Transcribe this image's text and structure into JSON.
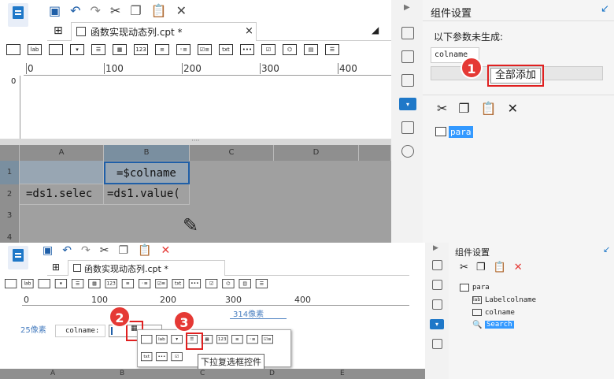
{
  "top": {
    "tab_title": "函数实现动态列.cpt *",
    "ruler_labels": [
      "0",
      "100",
      "200",
      "300",
      "400"
    ],
    "columns": [
      "A",
      "B",
      "C",
      "D"
    ],
    "rows": [
      "1",
      "2",
      "3",
      "4"
    ],
    "cell_b1": "=$colname",
    "cell_a2": "=ds1.selec",
    "cell_b2": "=ds1.value(",
    "panel_title": "组件设置",
    "params_label": "以下参数未生成:",
    "param_chip": "colname",
    "add_all_button": "全部添加",
    "tree_item": "para",
    "badge": "1"
  },
  "bottom": {
    "tab_title": "函数实现动态列.cpt *",
    "ruler_labels": [
      "0",
      "100",
      "200",
      "300",
      "400"
    ],
    "columns": [
      "A",
      "B",
      "C",
      "D",
      "E"
    ],
    "label_25px": "25像素",
    "label_314px": "314像素",
    "colname_label": "colname:",
    "panel_title": "组件设置",
    "tree": [
      "para",
      "Labelcolname",
      "colname",
      "Search"
    ],
    "tooltip": "下拉复选框控件",
    "badge2": "2",
    "badge3": "3",
    "ctrl_labels": [
      "lab",
      "123",
      "txt"
    ]
  },
  "colors": {
    "accent": "#1f78c8",
    "highlight": "#e02020",
    "grid": "#a0a0a0",
    "selected": "#3399ff"
  }
}
